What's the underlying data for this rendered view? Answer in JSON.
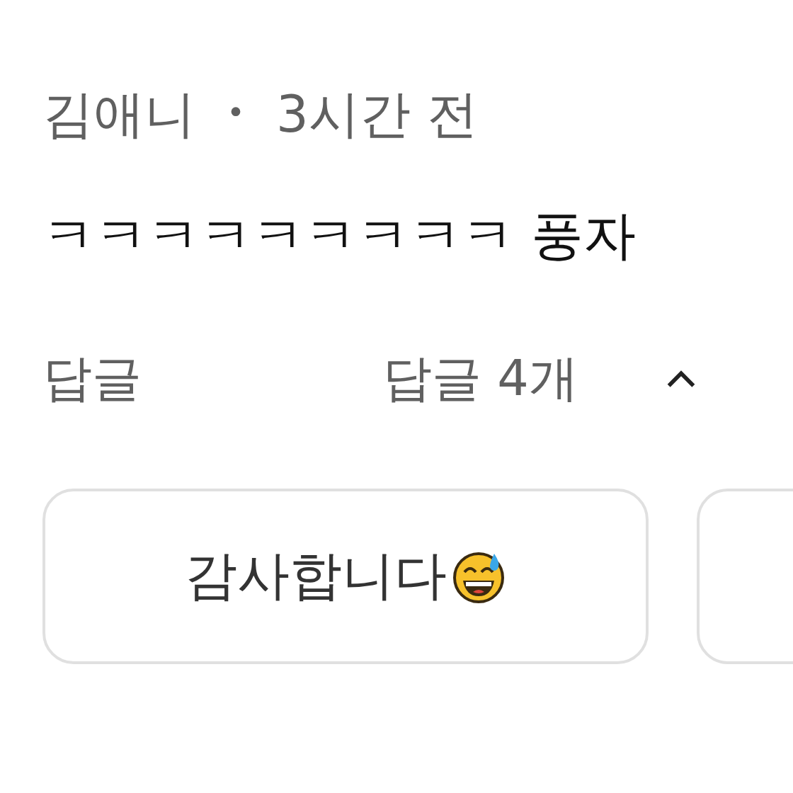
{
  "comment": {
    "author": "김애니",
    "separator": "•",
    "time": "3시간 전",
    "text": "ㅋㅋㅋㅋㅋㅋㅋㅋㅋ 풍자"
  },
  "reply_button": "답글",
  "replies_toggle": {
    "label": "답글 4개",
    "expanded": true
  },
  "suggestions": [
    {
      "label": "감사합니다",
      "emoji": true
    },
    {
      "emoji": false
    }
  ]
}
